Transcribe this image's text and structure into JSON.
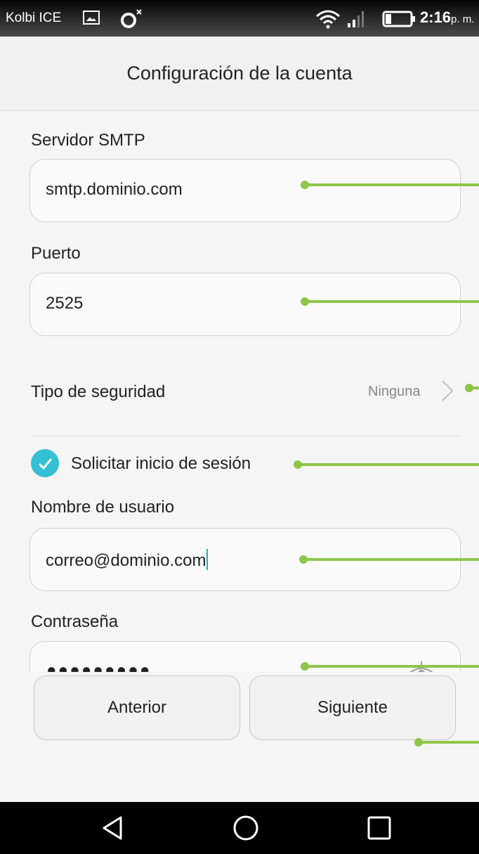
{
  "status_bar": {
    "carrier": "Kolbi ICE",
    "time": "2:16",
    "ampm": "p. m."
  },
  "header": {
    "title": "Configuración de la cuenta"
  },
  "form": {
    "smtp_server": {
      "label": "Servidor SMTP",
      "value": "smtp.dominio.com"
    },
    "port": {
      "label": "Puerto",
      "value": "2525"
    },
    "security": {
      "label": "Tipo de seguridad",
      "value": "Ninguna"
    },
    "require_login": {
      "label": "Solicitar inicio de sesión",
      "checked": true
    },
    "username": {
      "label": "Nombre de usuario",
      "value": "correo@dominio.com"
    },
    "password": {
      "label": "Contraseña",
      "value": "•••••••••"
    }
  },
  "buttons": {
    "previous": "Anterior",
    "next": "Siguiente"
  },
  "annotation_color": "#8ec64a",
  "accent_color": "#35c0d4"
}
